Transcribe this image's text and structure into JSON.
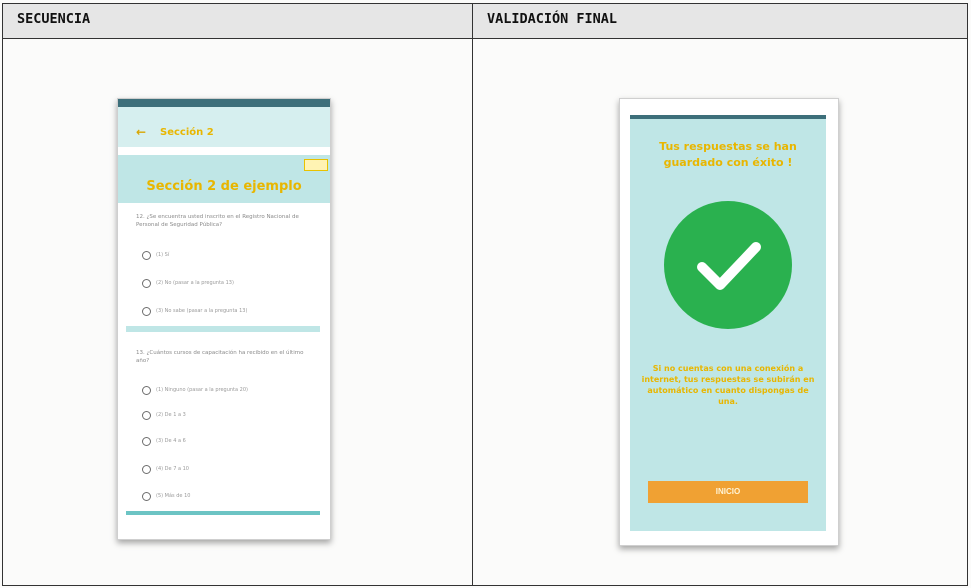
{
  "table": {
    "col1_header": "SECUENCIA",
    "col2_header": "VALIDACIÓN FINAL"
  },
  "phone_left": {
    "appbar_title": "Sección 2",
    "back_icon": "arrow-left-icon",
    "section_title": "Sección 2 de ejemplo",
    "question1": {
      "text": "12. ¿Se encuentra usted inscrito en el Registro Nacional de Personal de Seguridad Pública?",
      "options": [
        "(1) Sí",
        "(2) No (pasar a la pregunta 13)",
        "(3) No sabe (pasar a la pregunta 13)"
      ]
    },
    "question2": {
      "text": "13. ¿Cuántos cursos de capacitación ha recibido en el último año?",
      "options": [
        "(1) Ninguno (pasar a la pregunta 20)",
        "(2) De 1 a 3",
        "(3) De 4 a 6",
        "(4) De 7 a 10",
        "(5) Más de 10"
      ]
    }
  },
  "phone_right": {
    "title": "Tus respuestas se han guardado con éxito !",
    "icon": "check-circle-icon",
    "message": "Si no cuentas con una conexión a internet, tus respuestas se subirán en automático en cuanto dispongas de una.",
    "button_label": "INICIO"
  },
  "colors": {
    "teal_light": "#bfe6e6",
    "accent_yellow": "#e8b600",
    "success_green": "#2ab14f",
    "button_orange": "#f0a133"
  }
}
